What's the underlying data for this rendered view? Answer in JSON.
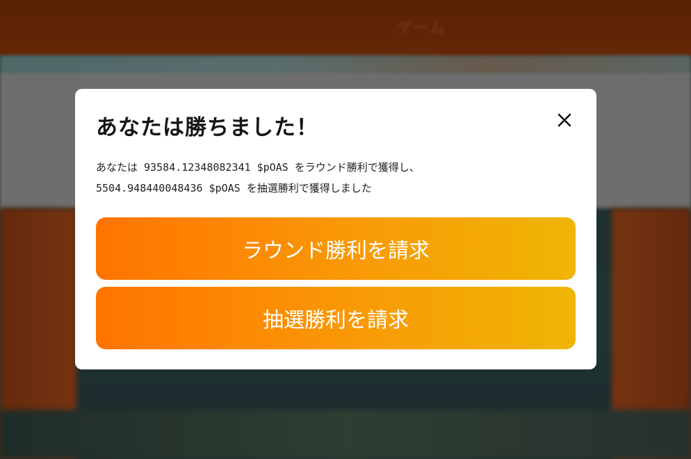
{
  "background": {
    "header_text": "ゲーム"
  },
  "modal": {
    "title": "あなたは勝ちました！",
    "close_label": "閉じる",
    "message": {
      "line1": "あなたは 93584.12348082341 $pOAS をラウンド勝利で獲得し、",
      "line2": "5504.948440048436 $pOAS を抽選勝利で獲得しました"
    },
    "buttons": {
      "claim_round": "ラウンド勝利を請求",
      "claim_lottery": "抽選勝利を請求"
    }
  },
  "colors": {
    "button_gradient_start": "#ff7400",
    "button_gradient_end": "#efb504",
    "modal_background": "#ffffff"
  },
  "icons": {
    "close": "close-icon"
  }
}
